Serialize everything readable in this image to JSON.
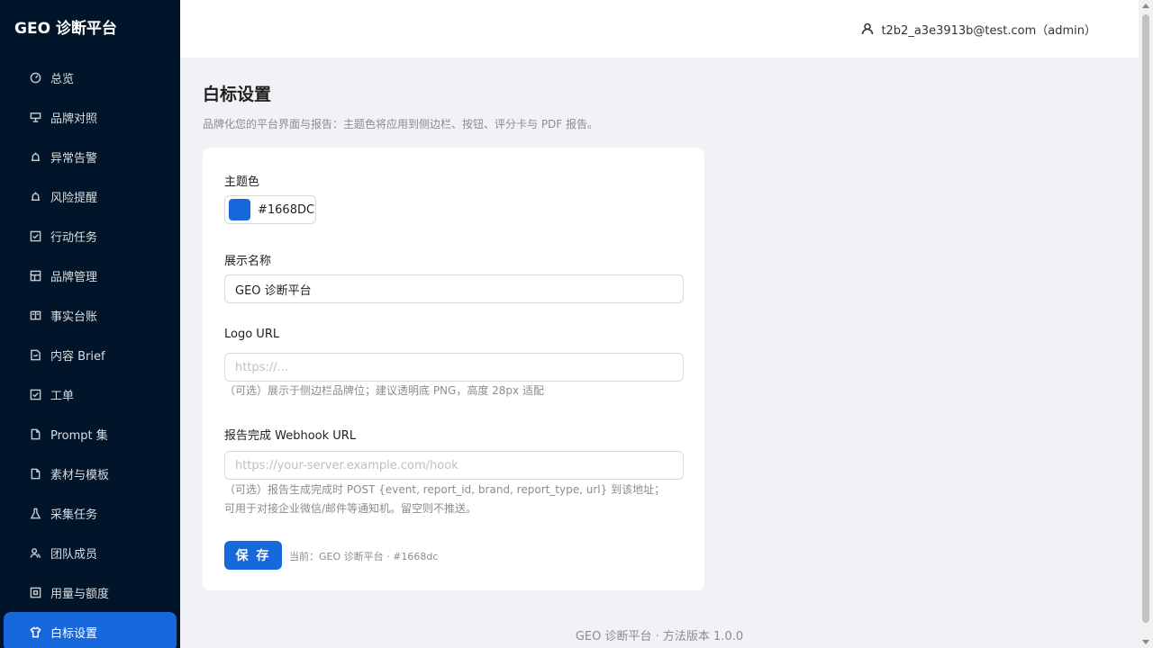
{
  "app": {
    "brand": "GEO 诊断平台"
  },
  "sidebar": {
    "items": [
      {
        "label": "总览",
        "icon": "dashboard-icon"
      },
      {
        "label": "品牌对照",
        "icon": "compare-icon"
      },
      {
        "label": "异常告警",
        "icon": "alert-icon"
      },
      {
        "label": "风险提醒",
        "icon": "warning-icon"
      },
      {
        "label": "行动任务",
        "icon": "task-icon"
      },
      {
        "label": "品牌管理",
        "icon": "brand-icon"
      },
      {
        "label": "事实台账",
        "icon": "ledger-icon"
      },
      {
        "label": "内容 Brief",
        "icon": "brief-icon"
      },
      {
        "label": "工单",
        "icon": "ticket-icon"
      },
      {
        "label": "Prompt 集",
        "icon": "file-icon"
      },
      {
        "label": "素材与模板",
        "icon": "template-icon"
      },
      {
        "label": "采集任务",
        "icon": "collect-icon"
      },
      {
        "label": "团队成员",
        "icon": "team-icon"
      },
      {
        "label": "用量与额度",
        "icon": "usage-icon"
      },
      {
        "label": "白标设置",
        "icon": "skin-icon",
        "active": true
      }
    ]
  },
  "header": {
    "user": "t2b2_a3e3913b@test.com（admin）"
  },
  "page": {
    "title": "白标设置",
    "description": "品牌化您的平台界面与报告：主题色将应用到侧边栏、按钮、评分卡与 PDF 报告。"
  },
  "form": {
    "primary_color": {
      "label": "主题色",
      "value": "#1668DC",
      "swatch": "#1668dc"
    },
    "display_name": {
      "label": "展示名称",
      "value": "GEO 诊断平台"
    },
    "logo_url": {
      "label": "Logo URL",
      "placeholder": "https://...",
      "help": "（可选）展示于侧边栏品牌位；建议透明底 PNG，高度 28px 适配"
    },
    "webhook": {
      "label": "报告完成 Webhook URL",
      "placeholder": "https://your-server.example.com/hook",
      "help": "（可选）报告生成完成时 POST {event, report_id, brand, report_type, url} 到该地址；可用于对接企业微信/邮件等通知机。留空则不推送。"
    },
    "save_label": "保 存",
    "current": "当前：GEO 诊断平台 · #1668dc"
  },
  "footer": "GEO 诊断平台 · 方法版本 1.0.0",
  "colors": {
    "sidebar_bg": "#001529",
    "accent": "#1668dc",
    "page_bg": "#f0f2f5"
  }
}
